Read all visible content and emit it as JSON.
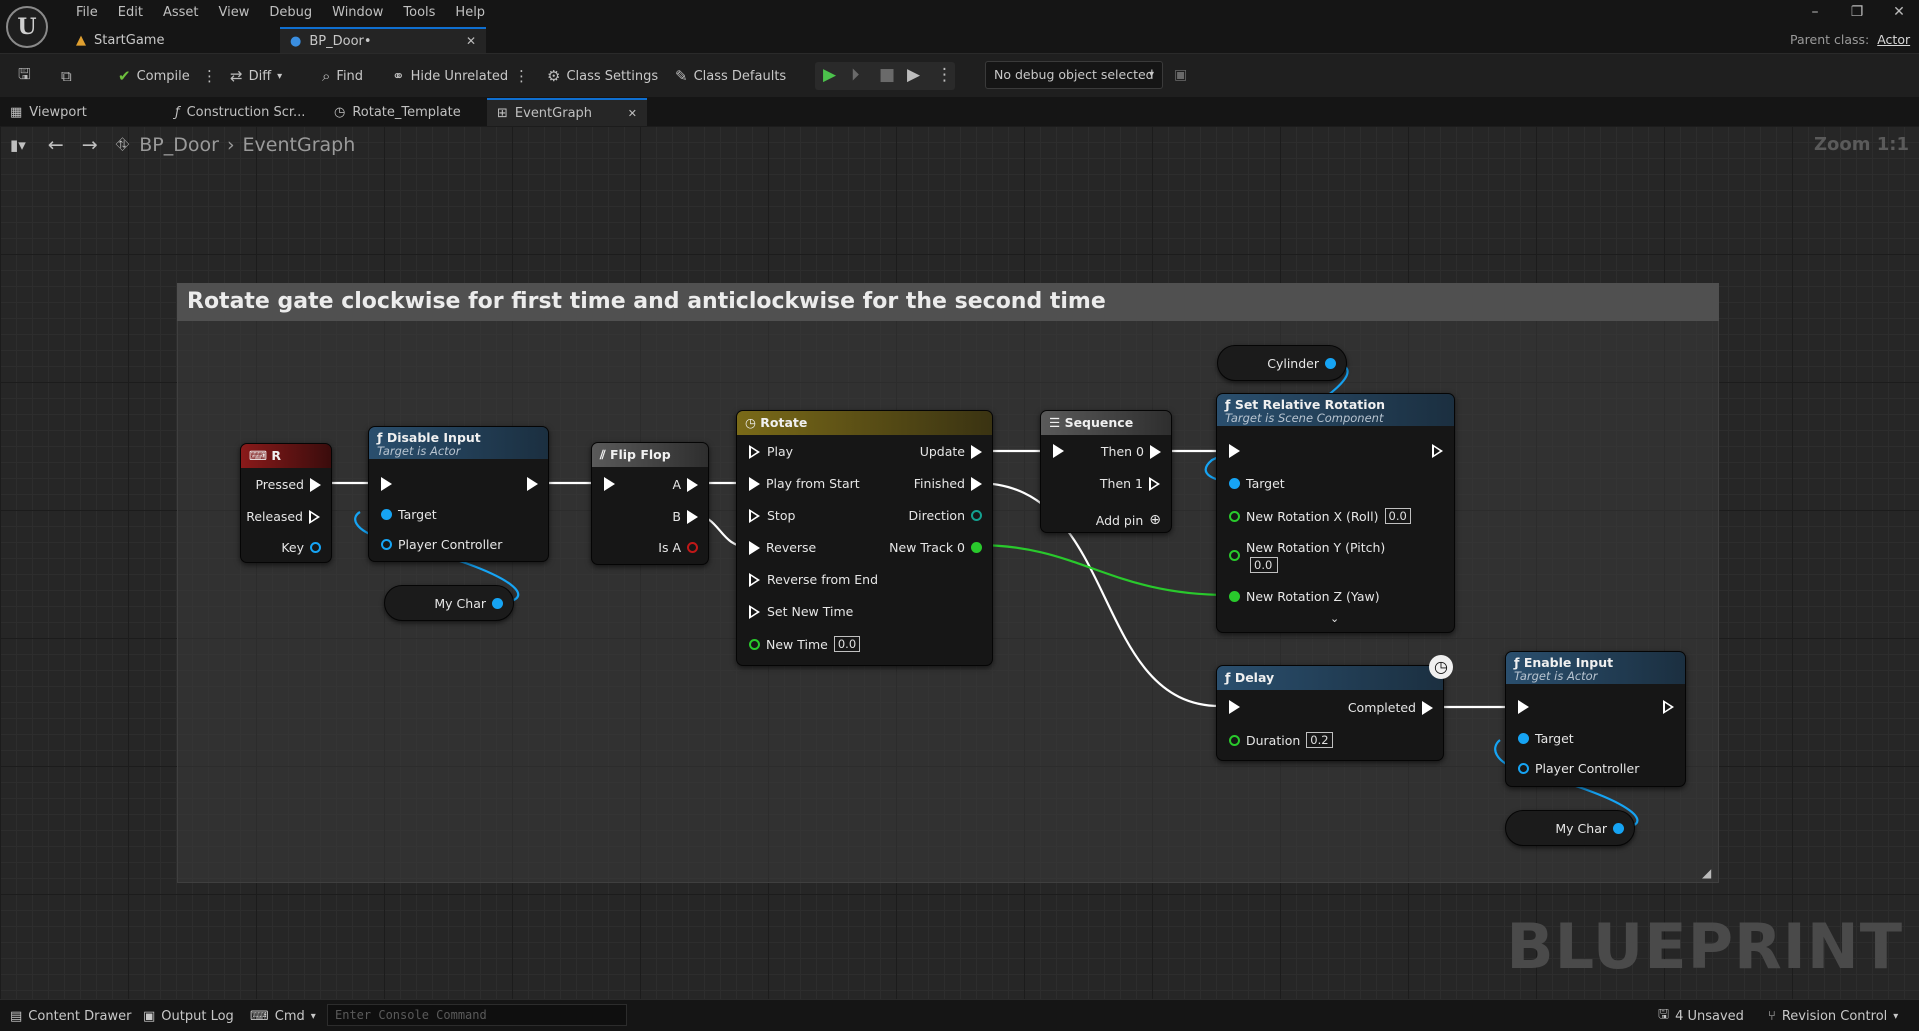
{
  "menu": [
    "File",
    "Edit",
    "Asset",
    "View",
    "Debug",
    "Window",
    "Tools",
    "Help"
  ],
  "doc_tabs": [
    {
      "label": "StartGame"
    },
    {
      "label": "BP_Door•"
    }
  ],
  "parent_class": {
    "label": "Parent class:",
    "value": "Actor"
  },
  "toolbar": {
    "compile": "Compile",
    "diff": "Diff",
    "find": "Find",
    "hide_unrelated": "Hide Unrelated",
    "class_settings": "Class Settings",
    "class_defaults": "Class Defaults",
    "debug_object": "No debug object selected"
  },
  "sub_tabs": [
    "Viewport",
    "Construction Scr...",
    "Rotate_Template",
    "EventGraph"
  ],
  "breadcrumb": {
    "root": "BP_Door",
    "current": "EventGraph"
  },
  "zoom": "Zoom 1:1",
  "watermark": "BLUEPRINT",
  "comment_title": "Rotate gate clockwise for first time and anticlockwise for the second time",
  "nodes": {
    "r_key": {
      "title": "R",
      "pins": [
        "Pressed",
        "Released",
        "Key"
      ]
    },
    "disable_input": {
      "title": "Disable Input",
      "subtitle": "Target is Actor",
      "pins": [
        "Target",
        "Player Controller"
      ]
    },
    "my_char_1": "My Char",
    "flipflop": {
      "title": "Flip Flop",
      "pins": [
        "A",
        "B",
        "Is A"
      ]
    },
    "rotate": {
      "title": "Rotate",
      "inputs": [
        "Play",
        "Play from Start",
        "Stop",
        "Reverse",
        "Reverse from End",
        "Set New Time",
        "New Time"
      ],
      "new_time": "0.0",
      "outputs": [
        "Update",
        "Finished",
        "Direction",
        "New Track 0"
      ]
    },
    "sequence": {
      "title": "Sequence",
      "pins": [
        "Then 0",
        "Then 1",
        "Add pin"
      ]
    },
    "cylinder": "Cylinder",
    "set_rotation": {
      "title": "Set Relative Rotation",
      "subtitle": "Target is Scene Component",
      "pins": [
        "Target",
        "New Rotation X (Roll)",
        "New Rotation Y (Pitch)",
        "New Rotation Z (Yaw)"
      ],
      "x": "0.0",
      "y": "0.0"
    },
    "delay": {
      "title": "Delay",
      "pins": [
        "Completed",
        "Duration"
      ],
      "duration": "0.2"
    },
    "enable_input": {
      "title": "Enable Input",
      "subtitle": "Target is Actor",
      "pins": [
        "Target",
        "Player Controller"
      ]
    },
    "my_char_2": "My Char"
  },
  "status": {
    "content_drawer": "Content Drawer",
    "output_log": "Output Log",
    "cmd": "Cmd",
    "console_placeholder": "Enter Console Command",
    "unsaved": "4 Unsaved",
    "revision": "Revision Control"
  }
}
